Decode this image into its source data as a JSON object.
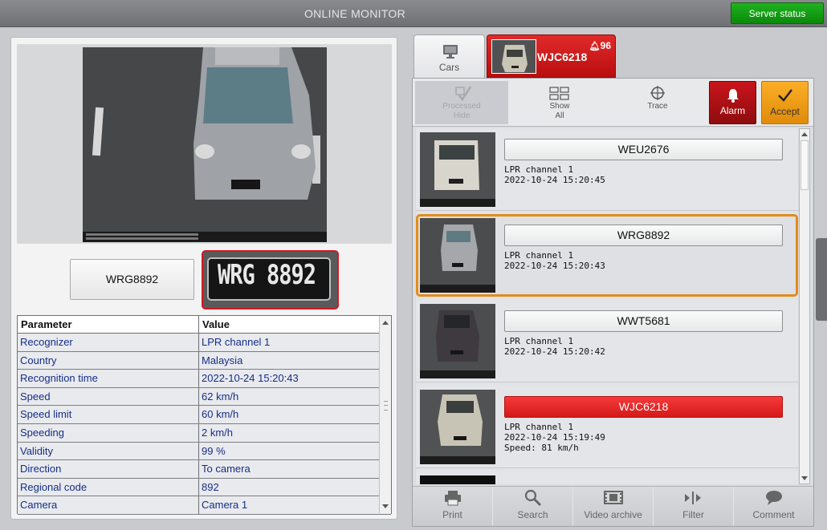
{
  "header": {
    "title": "ONLINE MONITOR",
    "server_status_label": "Server status"
  },
  "recognition": {
    "plate_text": "WRG8892",
    "plate_crop_text": "WRG 8892"
  },
  "params_table": {
    "headers": [
      "Parameter",
      "Value"
    ],
    "rows": [
      [
        "Recognizer",
        "LPR channel  1"
      ],
      [
        "Country",
        "Malaysia"
      ],
      [
        "Recognition time",
        "2022-10-24 15:20:43"
      ],
      [
        "Speed",
        "62 km/h"
      ],
      [
        "Speed limit",
        "60 km/h"
      ],
      [
        "Speeding",
        "2 km/h"
      ],
      [
        "Validity",
        "99 %"
      ],
      [
        "Direction",
        "To camera"
      ],
      [
        "Regional code",
        "892"
      ],
      [
        "Camera",
        "Camera 1"
      ]
    ]
  },
  "tabs": {
    "cars_label": "Cars",
    "alarm_plate": "WJC6218",
    "alarm_count": "96"
  },
  "toolbar": {
    "processed_line1": "Processed",
    "processed_line2": "Hide",
    "show_line1": "Show",
    "show_line2": "All",
    "trace_label": "Trace",
    "alarm_label": "Alarm",
    "accept_label": "Accept"
  },
  "events": [
    {
      "plate": "WEU2676",
      "channel": "LPR channel  1",
      "time": "2022-10-24 15:20:45",
      "speed": "",
      "alarm": false
    },
    {
      "plate": "WRG8892",
      "channel": "LPR channel  1",
      "time": "2022-10-24 15:20:43",
      "speed": "",
      "alarm": false
    },
    {
      "plate": "WWT5681",
      "channel": "LPR channel  1",
      "time": "2022-10-24 15:20:42",
      "speed": "",
      "alarm": false
    },
    {
      "plate": "WJC6218",
      "channel": "LPR channel  1",
      "time": "2022-10-24 15:19:49",
      "speed": "Speed: 81 km/h",
      "alarm": true
    }
  ],
  "bottombar": {
    "print": "Print",
    "search": "Search",
    "video_archive": "Video archive",
    "filter": "Filter",
    "comment": "Comment"
  },
  "colors": {
    "server_status_green": "#0b8a0b",
    "alarm_red": "#d51919",
    "selected_orange": "#e38c19",
    "accept_orange": "#f0a020",
    "table_text_blue": "#152e86"
  }
}
